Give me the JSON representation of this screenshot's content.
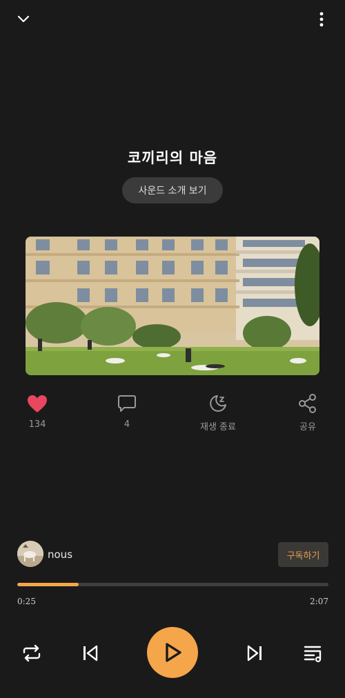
{
  "header": {
    "collapse_icon": "chevron-down-icon",
    "more_icon": "more-vertical-icon"
  },
  "track": {
    "title": "코끼리의 마음",
    "intro_button": "사운드 소개 보기"
  },
  "actions": {
    "like": {
      "icon": "heart-icon",
      "label": "134",
      "color": "#e8475f"
    },
    "comment": {
      "icon": "comment-icon",
      "label": "4"
    },
    "sleep_timer": {
      "icon": "moon-sleep-icon",
      "label": "재생 종료"
    },
    "share": {
      "icon": "share-icon",
      "label": "공유"
    }
  },
  "author": {
    "name": "nous",
    "subscribe_label": "구독하기"
  },
  "progress": {
    "current": "0:25",
    "total": "2:07",
    "fraction": 0.197
  },
  "controls": {
    "repeat_icon": "repeat-icon",
    "prev_icon": "skip-previous-icon",
    "play_icon": "play-icon",
    "next_icon": "skip-next-icon",
    "queue_icon": "playlist-icon"
  },
  "colors": {
    "accent": "#f5a54a",
    "background": "#1a1a1a",
    "like": "#e8475f"
  }
}
